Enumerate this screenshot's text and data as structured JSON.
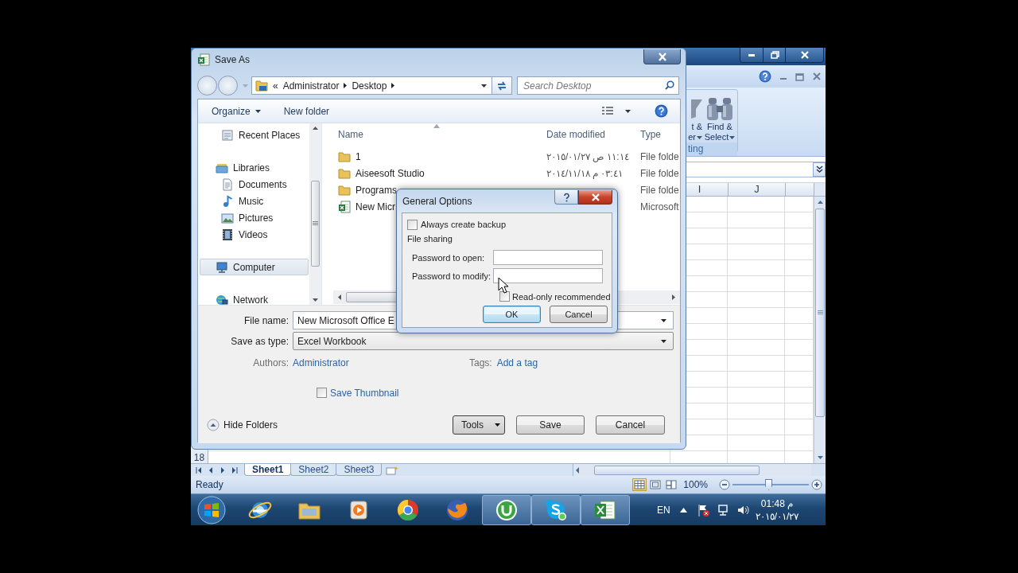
{
  "excel": {
    "ribbon": {
      "filter_lines": [
        "t &",
        "er"
      ],
      "find_lines": [
        "Find &",
        "Select"
      ],
      "group_label": "ting"
    },
    "columns": [
      "I",
      "J"
    ],
    "row_header": "18",
    "sheet_tabs": [
      {
        "label": "Sheet1",
        "selected": true
      },
      {
        "label": "Sheet2",
        "selected": false
      },
      {
        "label": "Sheet3",
        "selected": false
      }
    ],
    "status": "Ready",
    "views": [
      {
        "kind": "normal",
        "selected": true
      },
      {
        "kind": "layout",
        "selected": false
      },
      {
        "kind": "break",
        "selected": false
      }
    ],
    "zoom": {
      "reading": "100%",
      "level": 0.47
    }
  },
  "save_as": {
    "title": "Save As",
    "address": {
      "overflow": "«",
      "path": [
        "Administrator",
        "Desktop"
      ]
    },
    "search": {
      "placeholder": "Search Desktop"
    },
    "toolbar": {
      "organize": "Organize",
      "new_folder": "New folder"
    },
    "navigation": [
      {
        "children": [
          {
            "label": "Recent Places",
            "kind": "recent",
            "selected": false
          }
        ]
      },
      {
        "label": "Libraries",
        "kind": "library",
        "selected": false,
        "children": [
          {
            "label": "Documents",
            "kind": "documents",
            "selected": false
          },
          {
            "label": "Music",
            "kind": "music",
            "selected": false
          },
          {
            "label": "Pictures",
            "kind": "pictures",
            "selected": false
          },
          {
            "label": "Videos",
            "kind": "videos",
            "selected": false
          }
        ]
      },
      {
        "label": "Computer",
        "kind": "computer",
        "selected": true
      },
      {
        "label": "Network",
        "kind": "network",
        "selected": false
      }
    ],
    "columns": [
      "Name",
      "Date modified",
      "Type"
    ],
    "files": [
      {
        "name": "1",
        "date": "١١:١٤ ص ٢٠١٥/٠١/٢٧",
        "type": "File folde",
        "kind": "folder"
      },
      {
        "name": "Aiseesoft Studio",
        "date": "٠٣:٤١ م ٢٠١٤/١١/١٨",
        "type": "File folde",
        "kind": "folder"
      },
      {
        "name": "Programs",
        "type": "File folde",
        "kind": "folder"
      },
      {
        "name": "New Micr",
        "type": "Microsoft",
        "kind": "workbook"
      }
    ],
    "file_name": {
      "label": "File name:",
      "value": "New Microsoft Office E"
    },
    "save_type": {
      "label": "Save as type:",
      "value": "Excel Workbook"
    },
    "authors": {
      "label": "Authors:",
      "value": "Administrator"
    },
    "tags": {
      "label": "Tags:",
      "value": "Add a tag"
    },
    "save_thumbnail": {
      "label": "Save Thumbnail",
      "checked": false
    },
    "hide_folders": "Hide Folders",
    "buttons": {
      "tools": "Tools",
      "save": "Save",
      "cancel": "Cancel"
    }
  },
  "general_options": {
    "title": "General Options",
    "always_backup": {
      "label": "Always create backup",
      "checked": false
    },
    "section": "File sharing",
    "password_open": {
      "label": "Password to open:"
    },
    "password_modify": {
      "label": "Password to modify:"
    },
    "read_only": {
      "label": "Read-only recommended",
      "checked": false
    },
    "buttons": {
      "ok": "OK",
      "cancel": "Cancel"
    }
  },
  "taskbar": {
    "apps": [
      {
        "kind": "ie",
        "running": false
      },
      {
        "kind": "explorer",
        "running": false
      },
      {
        "kind": "media",
        "running": false
      },
      {
        "kind": "chrome",
        "running": false
      },
      {
        "kind": "firefox",
        "running": false
      },
      {
        "kind": "utorrent",
        "running": true
      },
      {
        "kind": "skype",
        "running": true
      },
      {
        "kind": "excel",
        "running": true
      }
    ],
    "language": "EN",
    "time": "01:48 م",
    "date": "٢٠١٥/٠١/٢٧"
  }
}
